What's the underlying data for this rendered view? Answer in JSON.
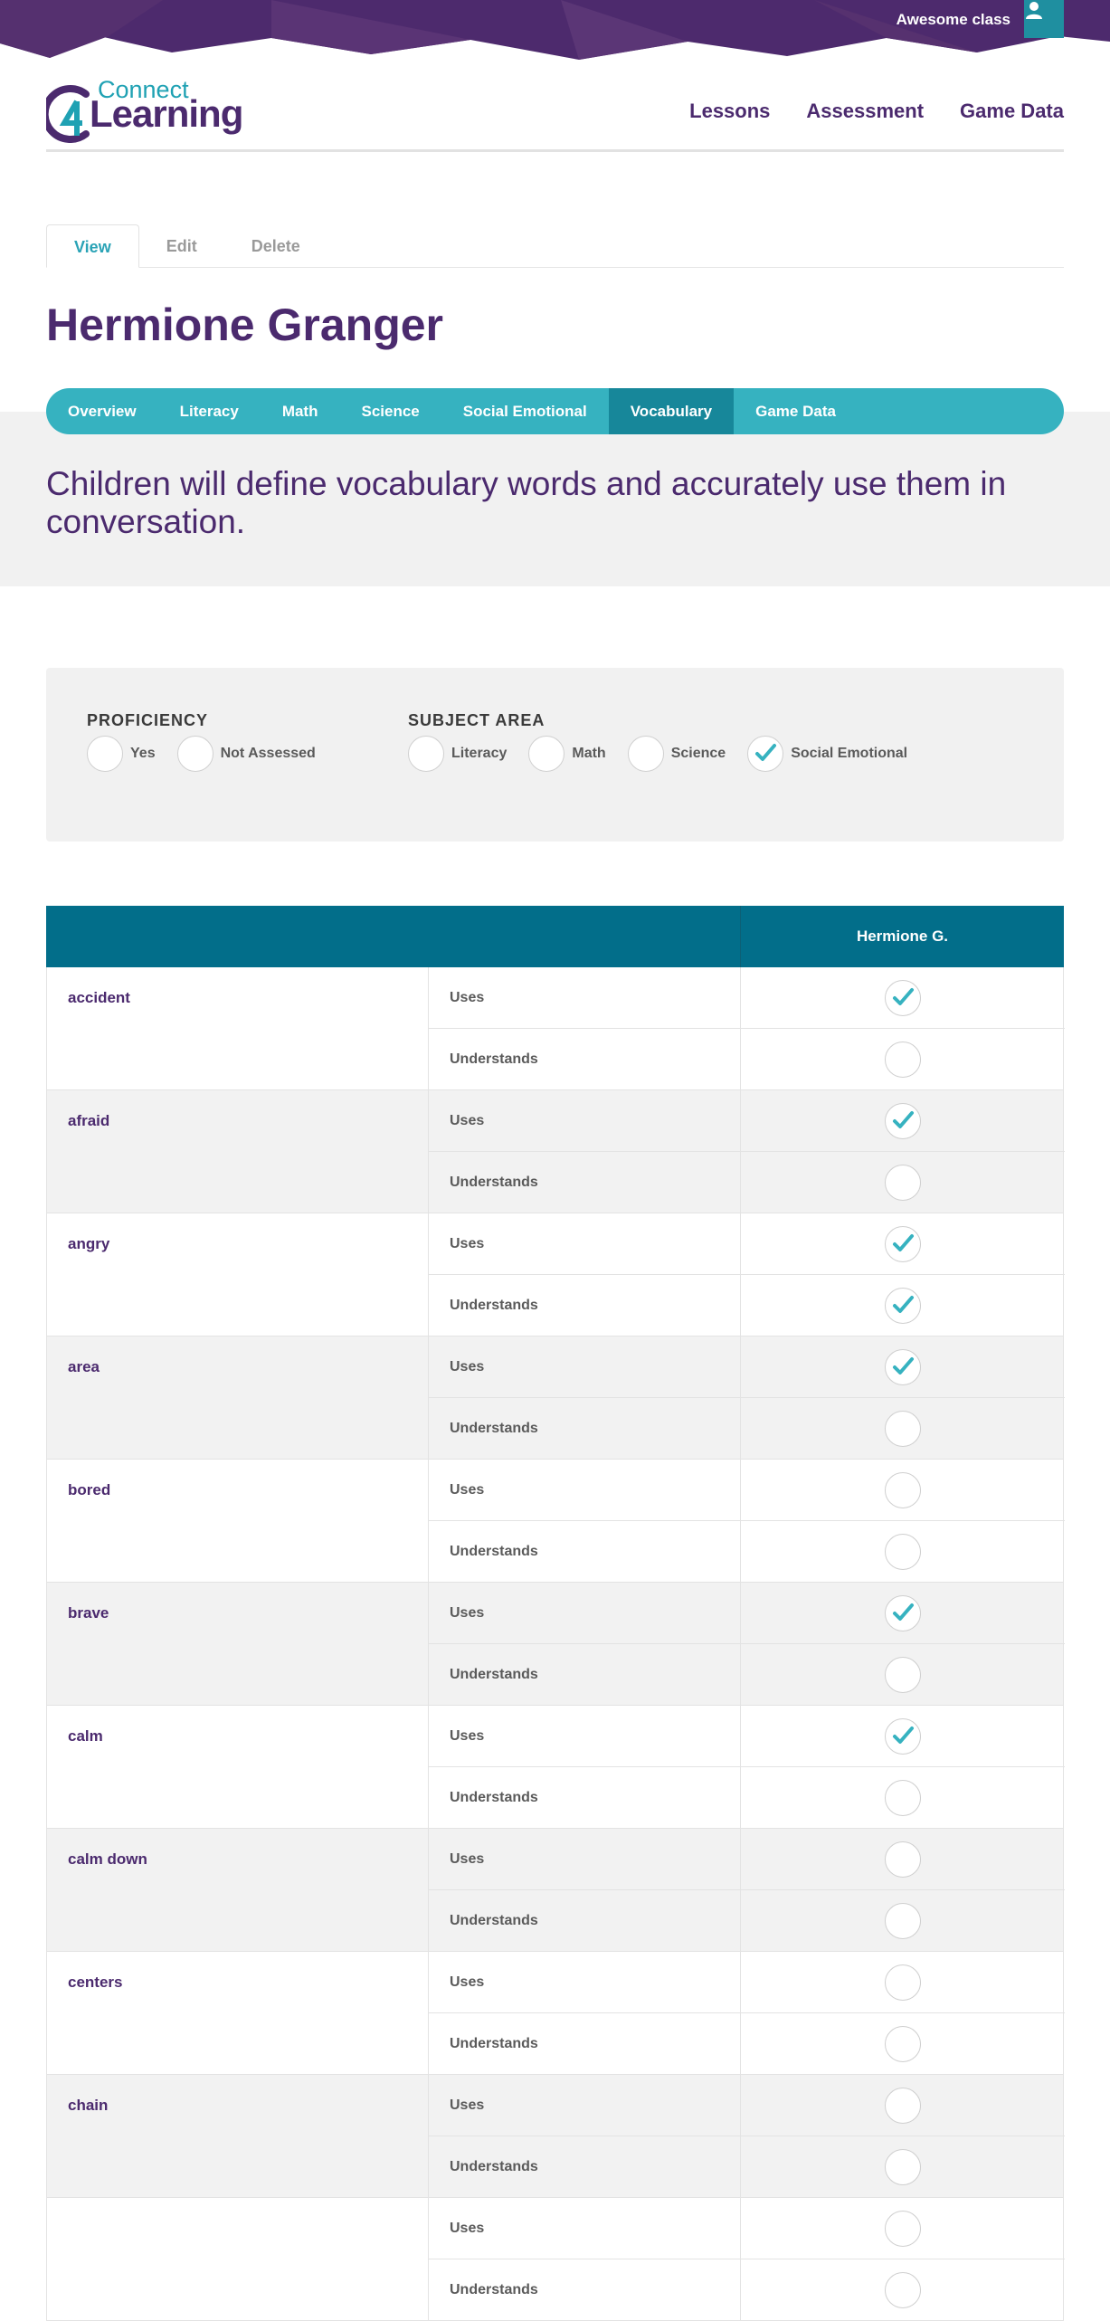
{
  "topbar": {
    "class_name": "Awesome class",
    "user_icon": "user-icon"
  },
  "logo": {
    "small": "Connect",
    "big": "Learning",
    "mark": "4"
  },
  "nav": [
    "Lessons",
    "Assessment",
    "Game Data"
  ],
  "action_tabs": [
    {
      "label": "View",
      "active": true
    },
    {
      "label": "Edit",
      "active": false
    },
    {
      "label": "Delete",
      "active": false
    }
  ],
  "student": {
    "name": "Hermione Granger"
  },
  "subject_tabs": [
    {
      "label": "Overview",
      "active": false
    },
    {
      "label": "Literacy",
      "active": false
    },
    {
      "label": "Math",
      "active": false
    },
    {
      "label": "Science",
      "active": false
    },
    {
      "label": "Social Emotional",
      "active": false
    },
    {
      "label": "Vocabulary",
      "active": true
    },
    {
      "label": "Game Data",
      "active": false
    }
  ],
  "intro_text": "Children will define vocabulary words and accurately use them in conversation.",
  "filters": {
    "proficiency": {
      "title": "PROFICIENCY",
      "options": [
        {
          "label": "Yes",
          "checked": false
        },
        {
          "label": "Not Assessed",
          "checked": false
        }
      ]
    },
    "subject_area": {
      "title": "SUBJECT AREA",
      "options": [
        {
          "label": "Literacy",
          "checked": false
        },
        {
          "label": "Math",
          "checked": false
        },
        {
          "label": "Science",
          "checked": false
        },
        {
          "label": "Social Emotional",
          "checked": true
        }
      ]
    }
  },
  "table": {
    "student_column": "Hermione G.",
    "uses_label": "Uses",
    "understands_label": "Understands",
    "rows": [
      {
        "word": "accident",
        "uses": true,
        "understands": false
      },
      {
        "word": "afraid",
        "uses": true,
        "understands": false
      },
      {
        "word": "angry",
        "uses": true,
        "understands": true
      },
      {
        "word": "area",
        "uses": true,
        "understands": false
      },
      {
        "word": "bored",
        "uses": false,
        "understands": false
      },
      {
        "word": "brave",
        "uses": true,
        "understands": false
      },
      {
        "word": "calm",
        "uses": true,
        "understands": false
      },
      {
        "word": "calm down",
        "uses": false,
        "understands": false
      },
      {
        "word": "centers",
        "uses": false,
        "understands": false
      },
      {
        "word": "chain",
        "uses": false,
        "understands": false
      },
      {
        "word": "",
        "uses": false,
        "understands": false
      }
    ]
  },
  "colors": {
    "brand_purple": "#4b2a6e",
    "teal": "#36b2c0",
    "teal_dark": "#17879a",
    "table_header": "#026e8a",
    "check": "#36b2c0"
  }
}
